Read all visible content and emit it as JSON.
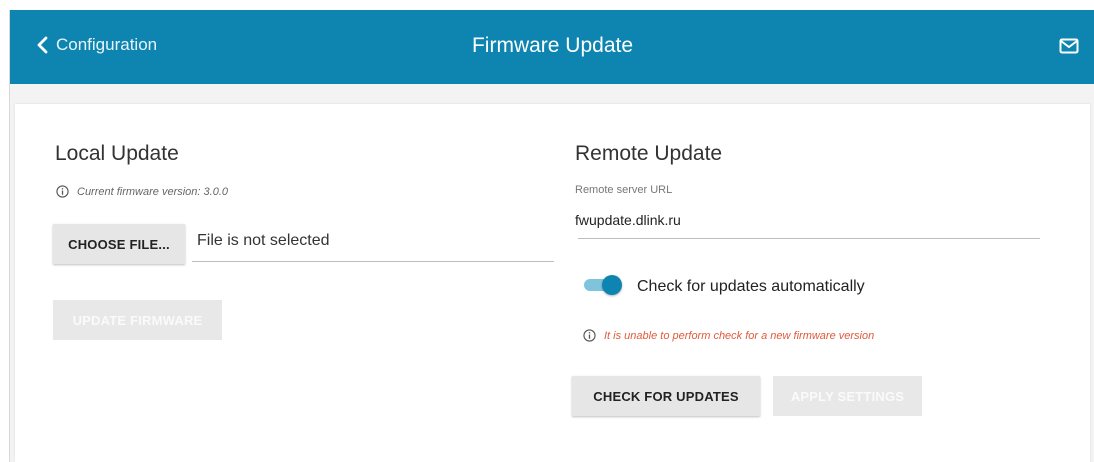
{
  "header": {
    "back_label": "Configuration",
    "title": "Firmware Update",
    "back_icon": "chevron-left-icon",
    "mail_icon": "mail-icon"
  },
  "local": {
    "title": "Local Update",
    "version_info": "Current firmware version: 3.0.0",
    "choose_file_label": "CHOOSE FILE...",
    "file_status": "File is not selected",
    "update_button": "UPDATE FIRMWARE"
  },
  "remote": {
    "title": "Remote Update",
    "url_label": "Remote server URL",
    "url_value": "fwupdate.dlink.ru",
    "auto_check_label": "Check for updates automatically",
    "auto_check_enabled": true,
    "error_text": "It is unable to perform check for a new firmware version",
    "check_button": "CHECK FOR UPDATES",
    "apply_button": "APPLY SETTINGS"
  },
  "colors": {
    "header_bg": "#0e85b0",
    "error": "#e05a3b",
    "toggle_on": "#0e85b0"
  }
}
